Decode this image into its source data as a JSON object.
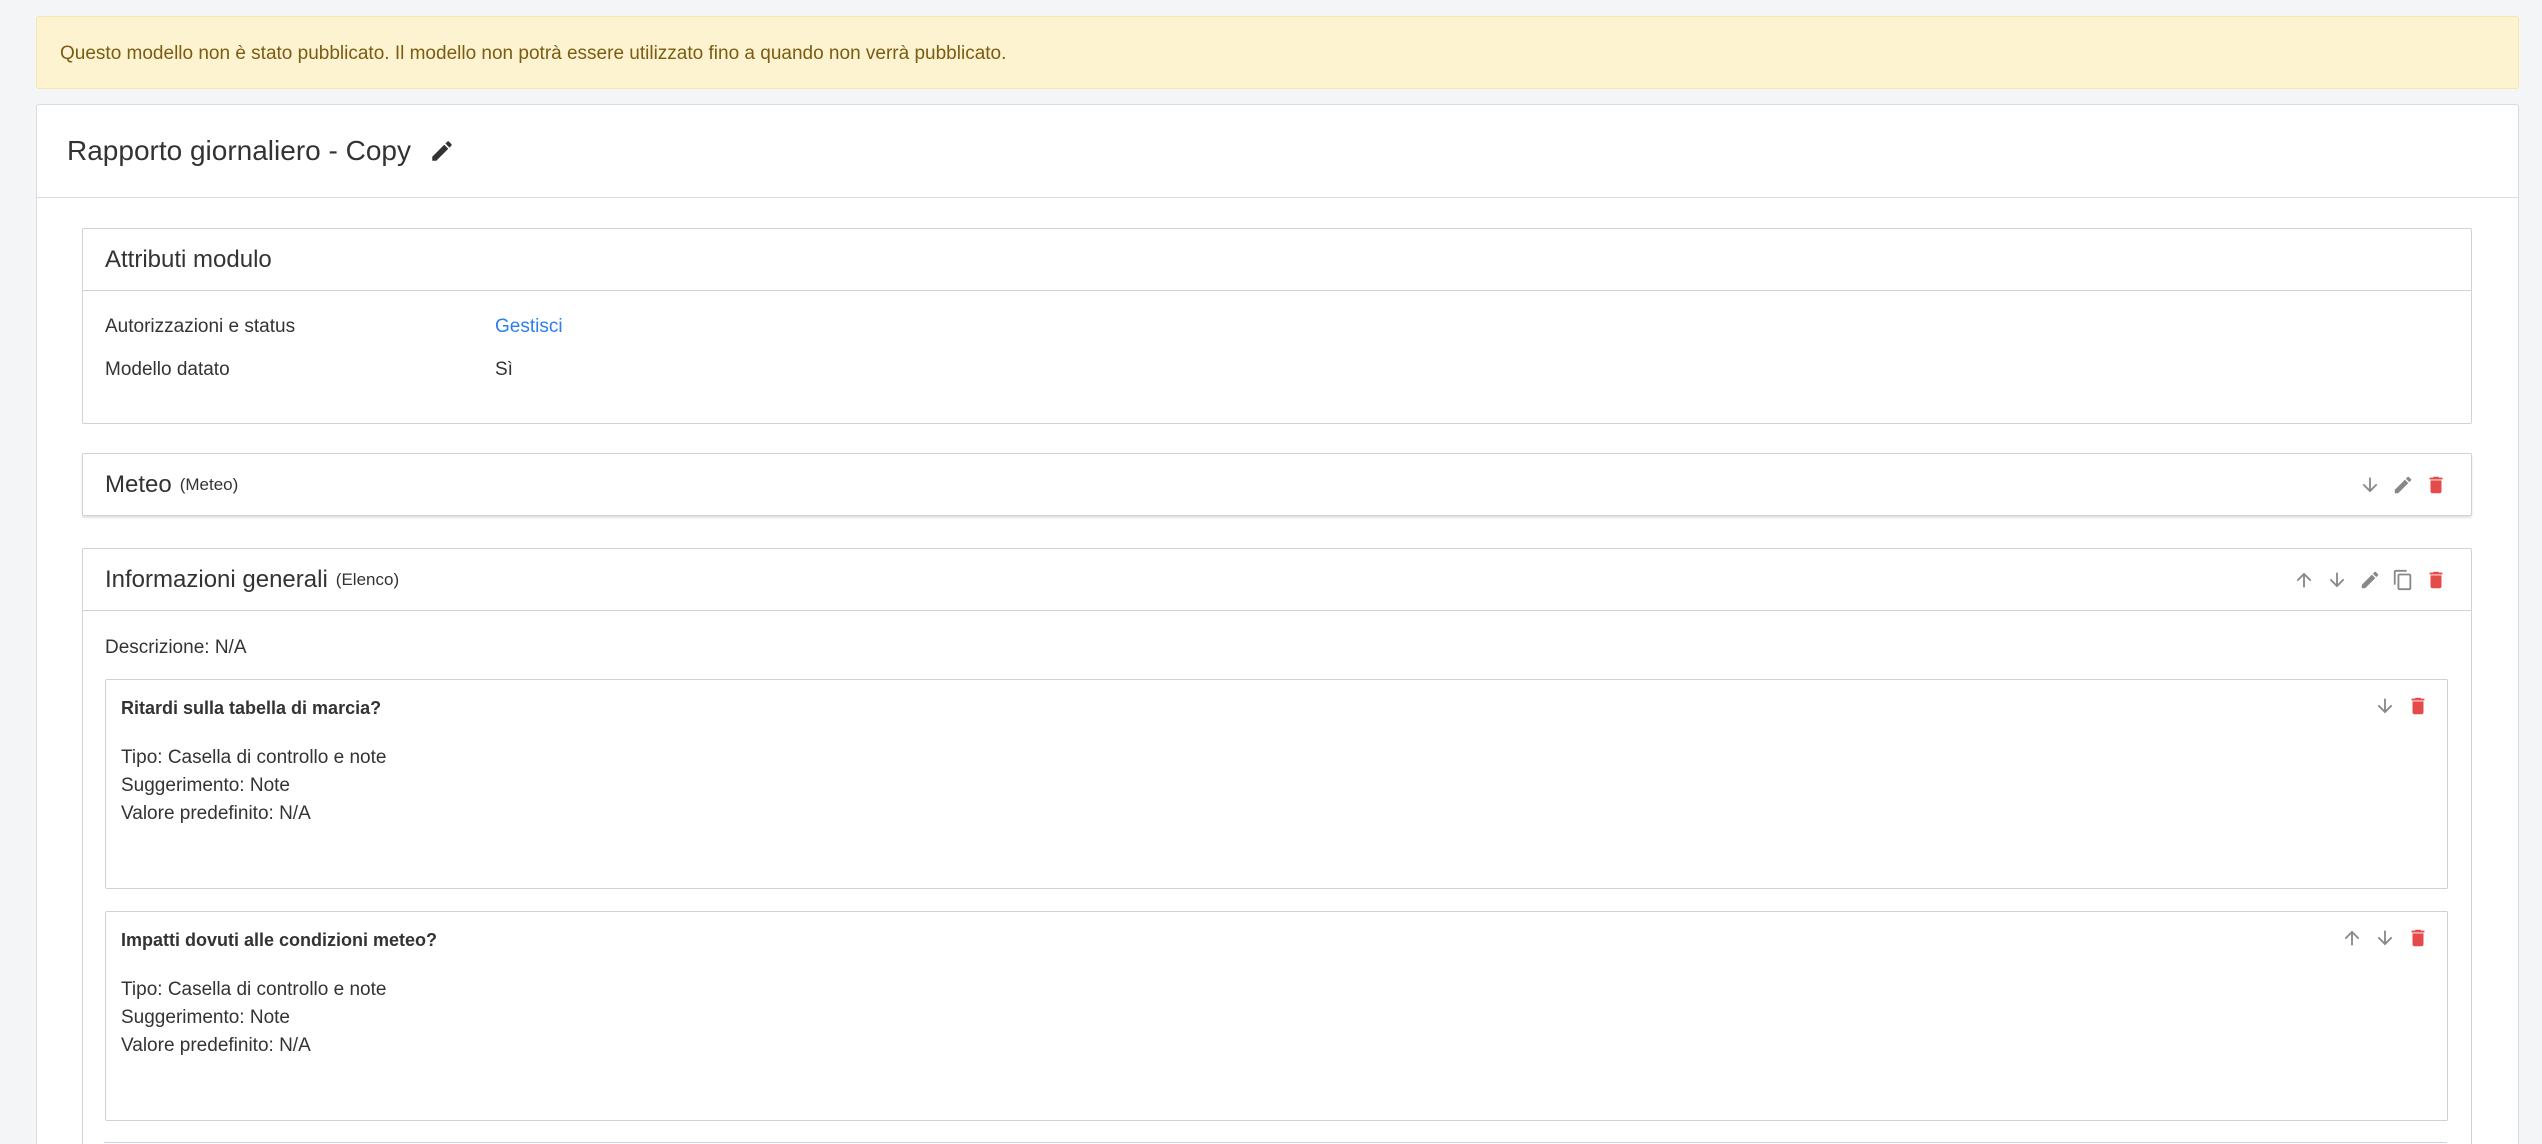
{
  "alert": {
    "text": "Questo modello non è stato pubblicato. Il modello non potrà essere utilizzato fino a quando non verrà pubblicato."
  },
  "template": {
    "title": "Rapporto giornaliero - Copy"
  },
  "attributes": {
    "title": "Attributi modulo",
    "rows": [
      {
        "label": "Autorizzazioni e status",
        "value": "Gestisci"
      },
      {
        "label": "Modello datato",
        "value": "Sì"
      }
    ]
  },
  "sections": [
    {
      "title": "Meteo",
      "type": "(Meteo)"
    },
    {
      "title": "Informazioni generali",
      "type": "(Elenco)",
      "description": "Descrizione: N/A",
      "questions": [
        {
          "title": "Ritardi sulla tabella di marcia?",
          "type": "Tipo: Casella di controllo e note",
          "hint": "Suggerimento: Note",
          "default": "Valore predefinito: N/A"
        },
        {
          "title": "Impatti dovuti alle condizioni meteo?",
          "type": "Tipo: Casella di controllo e note",
          "hint": "Suggerimento: Note",
          "default": "Valore predefinito: N/A"
        }
      ]
    }
  ],
  "colors": {
    "danger": "#e44b4b",
    "muted": "#888888",
    "link": "#2d7ff0",
    "alert_bg": "#fdf3d0"
  }
}
